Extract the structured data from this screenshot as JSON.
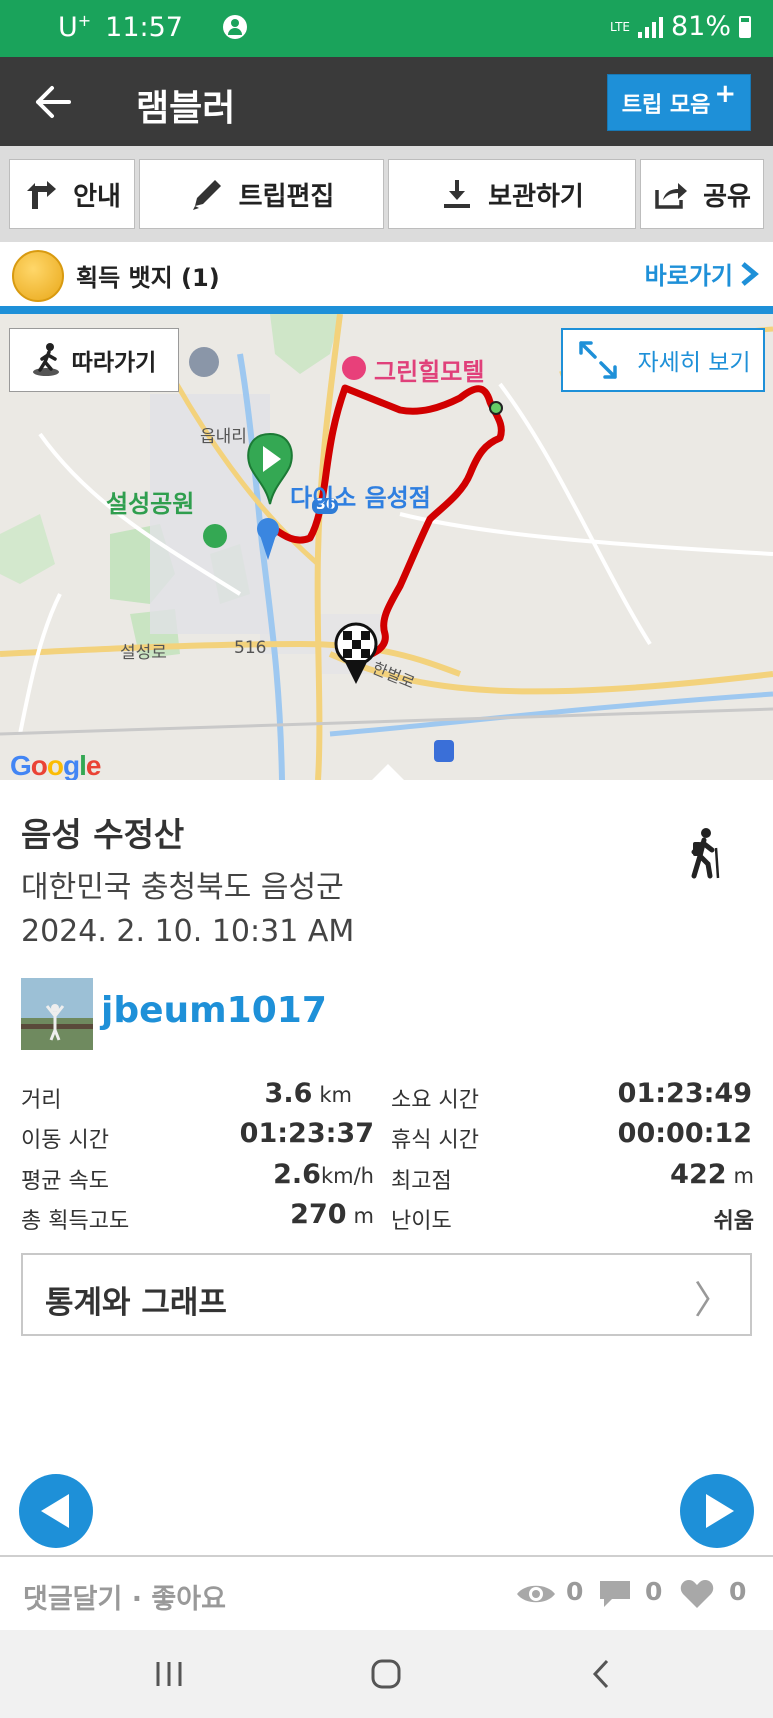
{
  "status": {
    "carrier": "U",
    "carrier_sup": "+",
    "time": "11:57",
    "network": "LTE",
    "battery": "81%"
  },
  "header": {
    "title": "램블러",
    "trip_button": "트립 모음",
    "trip_button_plus": "+"
  },
  "toolbar": {
    "guide": "안내",
    "edit": "트립편집",
    "save": "보관하기",
    "share": "공유"
  },
  "badges": {
    "label": "획득 뱃지 (1)",
    "goto": "바로가기"
  },
  "map": {
    "follow": "따라가기",
    "detail": "자세히 보기",
    "poi_motel": "그린힐모텔",
    "poi_daiso": "다이소 음성점",
    "poi_park": "설성공원",
    "area_eup": "읍내리",
    "road_seolseong": "설성로",
    "road_516": "516",
    "road_36": "36",
    "road_hanbeol": "한벌로",
    "google": "Google"
  },
  "trip": {
    "title": "음성 수정산",
    "location": "대한민국 충청북도 음성군",
    "datetime": "2024. 2. 10. 10:31 AM",
    "username": "jbeum1017"
  },
  "stats": {
    "distance_label": "거리",
    "distance_value": "3.6",
    "distance_unit": "km",
    "total_time_label": "소요 시간",
    "total_time_value": "01:23:49",
    "moving_time_label": "이동 시간",
    "moving_time_value": "01:23:37",
    "rest_time_label": "휴식 시간",
    "rest_time_value": "00:00:12",
    "avg_speed_label": "평균 속도",
    "avg_speed_value": "2.6",
    "avg_speed_unit": "km/h",
    "max_alt_label": "최고점",
    "max_alt_value": "422",
    "max_alt_unit": "m",
    "gain_label": "총 획득고도",
    "gain_value": "270",
    "gain_unit": "m",
    "difficulty_label": "난이도",
    "difficulty_value": "쉬움"
  },
  "stats_button": {
    "label": "통계와 그래프",
    "arrow": "〉"
  },
  "footer": {
    "comment_like": "댓글달기 · 좋아요",
    "views": "0",
    "comments": "0",
    "likes": "0"
  },
  "colors": {
    "status_green": "#1aa35b",
    "header_dark": "#3a3a3a",
    "accent_blue": "#1e90d8",
    "route_red": "#d10000"
  }
}
